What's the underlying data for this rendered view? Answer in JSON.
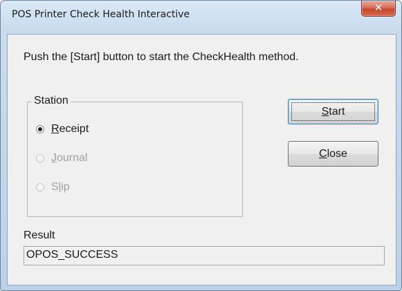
{
  "window": {
    "title": "POS Printer Check Health Interactive",
    "close_glyph": "✕"
  },
  "instruction": "Push the [Start] button to start the CheckHealth method.",
  "station": {
    "label": "Station",
    "options": [
      {
        "pre": "",
        "mnemonic": "R",
        "post": "eceipt",
        "checked": true,
        "enabled": true
      },
      {
        "pre": "",
        "mnemonic": "J",
        "post": "ournal",
        "checked": false,
        "enabled": false
      },
      {
        "pre": "S",
        "mnemonic": "l",
        "post": "ip",
        "checked": false,
        "enabled": false
      }
    ]
  },
  "buttons": {
    "start": {
      "mnemonic": "S",
      "post": "tart"
    },
    "close": {
      "mnemonic": "C",
      "post": "lose"
    }
  },
  "result": {
    "label": "Result",
    "value": "OPOS_SUCCESS"
  }
}
